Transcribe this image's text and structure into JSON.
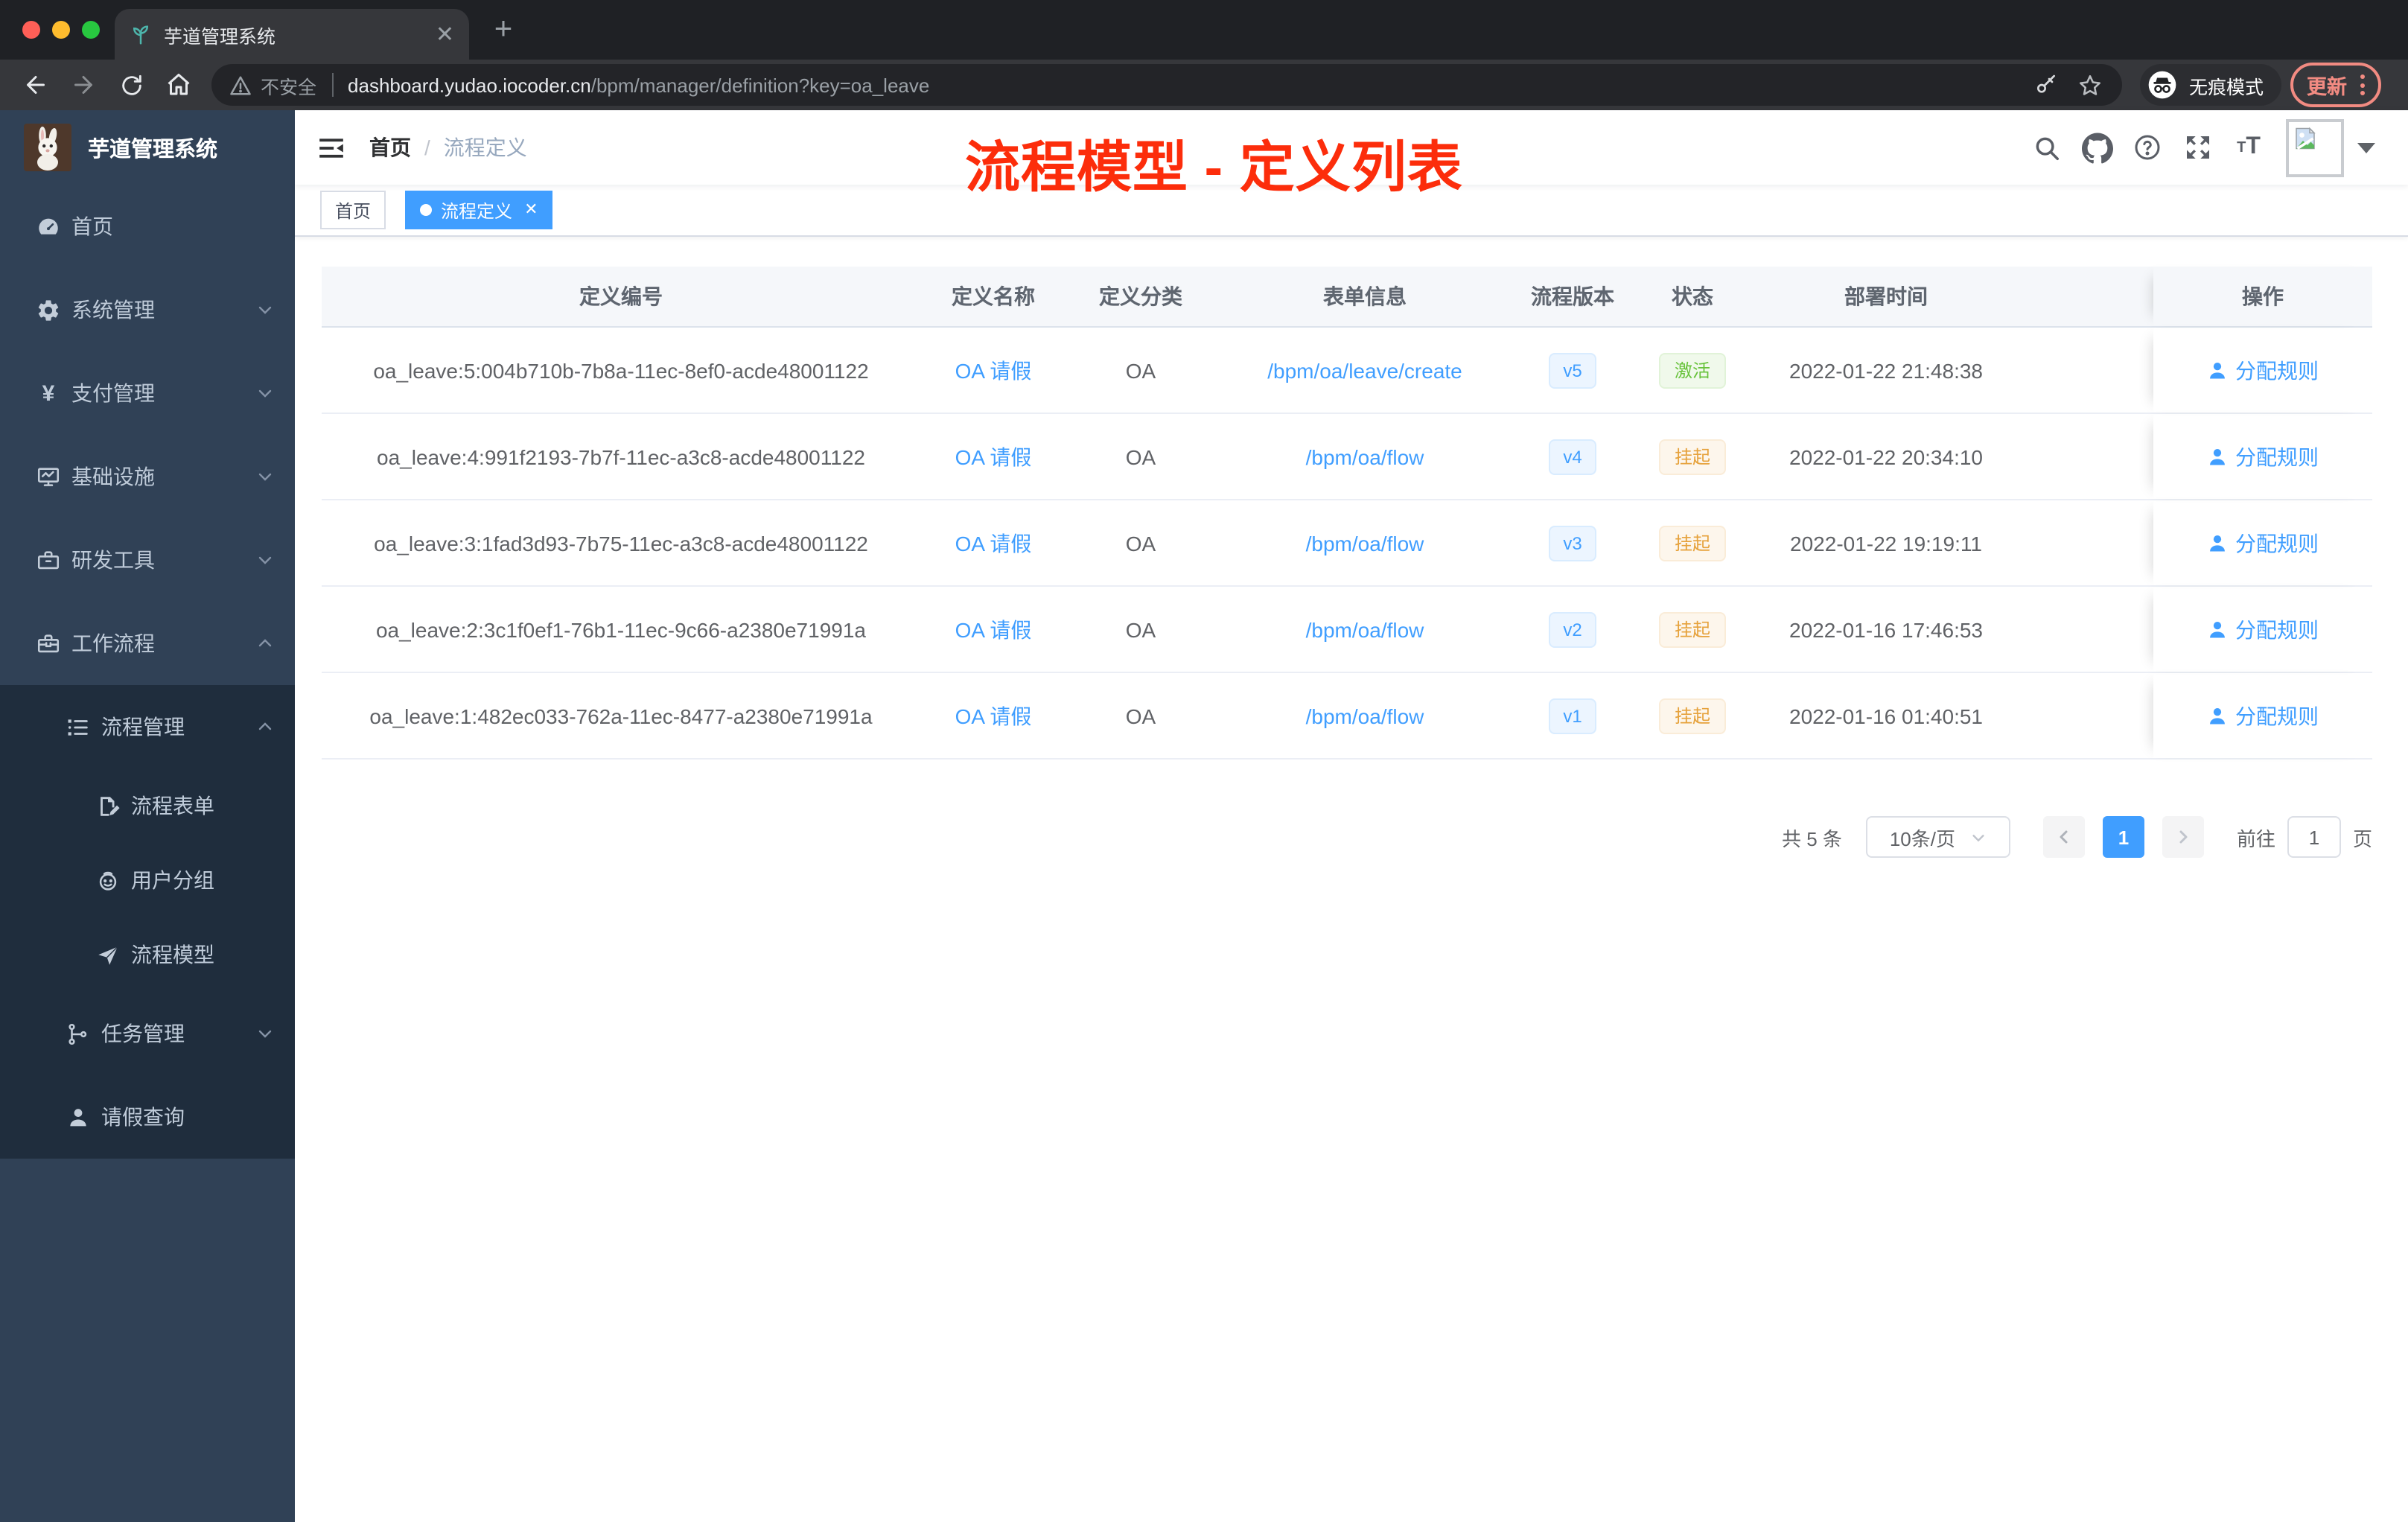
{
  "browser": {
    "tab_title": "芋道管理系统",
    "security_label": "不安全",
    "url_host": "dashboard.yudao.iocoder.cn",
    "url_path": "/bpm/manager/definition?key=oa_leave",
    "incognito_label": "无痕模式",
    "update_label": "更新"
  },
  "sidebar": {
    "logo_title": "芋道管理系统",
    "items": {
      "home": "首页",
      "system": "系统管理",
      "pay": "支付管理",
      "infra": "基础设施",
      "dev": "研发工具",
      "workflow": "工作流程",
      "process_mgmt": "流程管理",
      "process_form": "流程表单",
      "user_group": "用户分组",
      "process_model": "流程模型",
      "task_mgmt": "任务管理",
      "leave_query": "请假查询"
    }
  },
  "header": {
    "breadcrumb": {
      "home": "首页",
      "separator": "/",
      "current": "流程定义"
    },
    "annotation": "流程模型 - 定义列表"
  },
  "tags": {
    "home": "首页",
    "active": "流程定义"
  },
  "table": {
    "columns": [
      "定义编号",
      "定义名称",
      "定义分类",
      "表单信息",
      "流程版本",
      "状态",
      "部署时间",
      "操作"
    ],
    "action_label": "分配规则",
    "rows": [
      {
        "id": "oa_leave:5:004b710b-7b8a-11ec-8ef0-acde48001122",
        "name": "OA 请假",
        "category": "OA",
        "form": "/bpm/oa/leave/create",
        "version": "v5",
        "status": "激活",
        "time": "2022-01-22 21:48:38"
      },
      {
        "id": "oa_leave:4:991f2193-7b7f-11ec-a3c8-acde48001122",
        "name": "OA 请假",
        "category": "OA",
        "form": "/bpm/oa/flow",
        "version": "v4",
        "status": "挂起",
        "time": "2022-01-22 20:34:10"
      },
      {
        "id": "oa_leave:3:1fad3d93-7b75-11ec-a3c8-acde48001122",
        "name": "OA 请假",
        "category": "OA",
        "form": "/bpm/oa/flow",
        "version": "v3",
        "status": "挂起",
        "time": "2022-01-22 19:19:11"
      },
      {
        "id": "oa_leave:2:3c1f0ef1-76b1-11ec-9c66-a2380e71991a",
        "name": "OA 请假",
        "category": "OA",
        "form": "/bpm/oa/flow",
        "version": "v2",
        "status": "挂起",
        "time": "2022-01-16 17:46:53"
      },
      {
        "id": "oa_leave:1:482ec033-762a-11ec-8477-a2380e71991a",
        "name": "OA 请假",
        "category": "OA",
        "form": "/bpm/oa/flow",
        "version": "v1",
        "status": "挂起",
        "time": "2022-01-16 01:40:51"
      }
    ]
  },
  "pagination": {
    "total": "共 5 条",
    "page_size": "10条/页",
    "current_page": "1",
    "jump_prefix": "前往",
    "jump_suffix": "页",
    "jumper_value": "1"
  },
  "colors": {
    "accent_blue": "#409eff",
    "status_active_green": "#67c23a",
    "status_suspended_orange": "#e6a23c",
    "sidebar_bg": "#304156",
    "submenu_bg": "#1f2d3d",
    "annotation_red": "#fc2d0b",
    "chrome_update_red": "#f28b82"
  }
}
